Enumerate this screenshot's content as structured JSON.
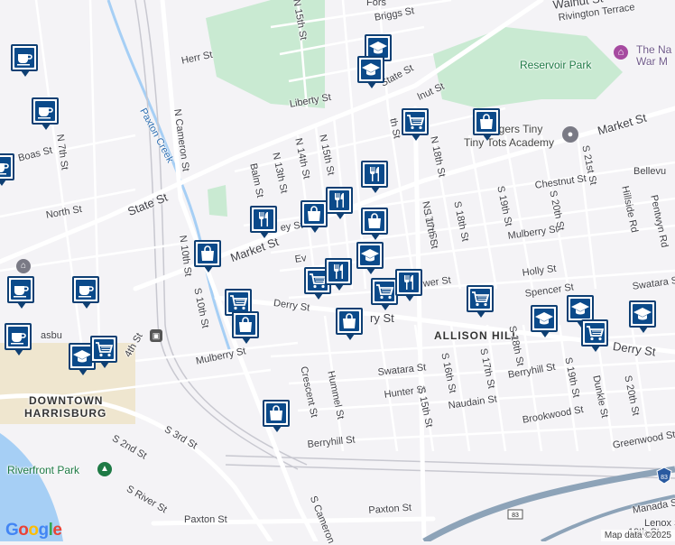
{
  "map": {
    "attribution": "Map data ©2025",
    "logo": "Google",
    "colors": {
      "land": "#f4f3f6",
      "park": "#c9ead2",
      "water": "#a6cff5",
      "road_major": "#ffffff",
      "marker_fill": "#0b4a8a",
      "marker_border": "#0e3f73"
    }
  },
  "labels": {
    "area": {
      "allison_hill": "ALLISON HILL",
      "downtown_1": "DOWNTOWN",
      "downtown_2": "HARRISBURG"
    },
    "parks": {
      "reservoir": "Reservoir Park",
      "riverfront": "Riverfront Park"
    },
    "pois": {
      "war_museum_1": "The Na",
      "war_museum_2": "War M",
      "tiny_tots": "Tiny Tots Academy",
      "tiny_tots_prefix": "Ti",
      "tiny_tots_rest": "ngers Tiny",
      "bellevue": "Bellevu",
      "paxton_creek": "Paxton Creek"
    },
    "streets": {
      "walnut_top": "Walnut St",
      "rivington": "Rivington Terrace",
      "briggs": "Briggs St",
      "forster": "Fors",
      "herr": "Herr St",
      "n15th_top": "N 15th St",
      "n17th_top_stub": "th St",
      "liberty": "Liberty St",
      "state_upper": "State St",
      "walnut_mid": "lnut St",
      "market_right": "Market St",
      "n18th": "N 18th St",
      "n17th": "N 17th St",
      "n13th": "N 13th St",
      "n14th": "N 14th St",
      "n15th": "N 15th St",
      "n16th": "N 16th St",
      "balm": "Balm St",
      "state_lower": "State St",
      "north": "North St",
      "boas": "Boas St",
      "n7th": "N 7th St",
      "n_cameron": "N Cameron St",
      "n10th": "N 10th St",
      "s10th": "S 10th St",
      "market_left": "Market St",
      "derry_left": "Derry St",
      "derry_mid": "Derry St",
      "derry_right": "Derry St",
      "mulberry_left": "Mulberry St",
      "mulberry_right": "Mulberry St",
      "chestnut": "Chestnut St",
      "holly": "Holly St",
      "spencer": "Spencer St",
      "swatara_right": "Swatara St",
      "swatara_mid": "Swatara St",
      "s17th_mid": "S 17th St",
      "s18th_mid": "S 18th St",
      "s19th_top": "S 19th St",
      "s20th_top": "S 20th St",
      "s21st": "S 21st St",
      "hillside": "Hillside Rd",
      "pentwyn": "Pentwyn Rd",
      "s16th": "S 16th St",
      "s17th_low": "S 17th St",
      "s18th_low": "S 18th St",
      "s19th_low": "S 19th St",
      "dunkle": "Dunkle St",
      "s20th_low": "S 20th St",
      "berryhill_right": "Berryhill St",
      "brookwood": "Brookwood St",
      "greenwood": "Greenwood St",
      "hummel": "Hummel St",
      "crescent": "Crescent St",
      "hunter": "Hunter St",
      "s15th": "S 15th St",
      "naudain": "Naudain St",
      "berryhill_left": "Berryhill St",
      "s2nd": "S 2nd St",
      "s3rd": "S 3rd St",
      "s_river": "S River St",
      "paxton_left": "Paxton St",
      "paxton_mid": "Paxton St",
      "s_cameron": "S Cameron",
      "manada": "Manada St",
      "s19th_bottom": "19th St",
      "lenox": "Lenox S",
      "evergreen_stub": "Ev",
      "derry_stub": "ry St",
      "mulberry_stub": "ey St",
      "sixth_stub": "Su",
      "wer_stub": "wer St",
      "asbu": "asbu",
      "a4th": "4th St",
      "s_frag": "S"
    },
    "shields": {
      "i83": "83",
      "us22": "22"
    }
  },
  "markers": [
    {
      "icon": "cafe"
    },
    {
      "icon": "cafe"
    },
    {
      "icon": "cafe"
    },
    {
      "icon": "cafe"
    },
    {
      "icon": "cafe"
    },
    {
      "icon": "cafe"
    },
    {
      "icon": "school"
    },
    {
      "icon": "school"
    },
    {
      "icon": "school"
    },
    {
      "icon": "school"
    },
    {
      "icon": "school"
    },
    {
      "icon": "school"
    },
    {
      "icon": "school"
    },
    {
      "icon": "grocery"
    },
    {
      "icon": "grocery"
    },
    {
      "icon": "grocery"
    },
    {
      "icon": "grocery"
    },
    {
      "icon": "grocery"
    },
    {
      "icon": "grocery"
    },
    {
      "icon": "grocery"
    },
    {
      "icon": "shopping"
    },
    {
      "icon": "shopping"
    },
    {
      "icon": "shopping"
    },
    {
      "icon": "shopping"
    },
    {
      "icon": "shopping"
    },
    {
      "icon": "shopping"
    },
    {
      "icon": "shopping"
    },
    {
      "icon": "restaurant"
    },
    {
      "icon": "restaurant"
    },
    {
      "icon": "restaurant"
    },
    {
      "icon": "restaurant"
    },
    {
      "icon": "restaurant"
    }
  ]
}
